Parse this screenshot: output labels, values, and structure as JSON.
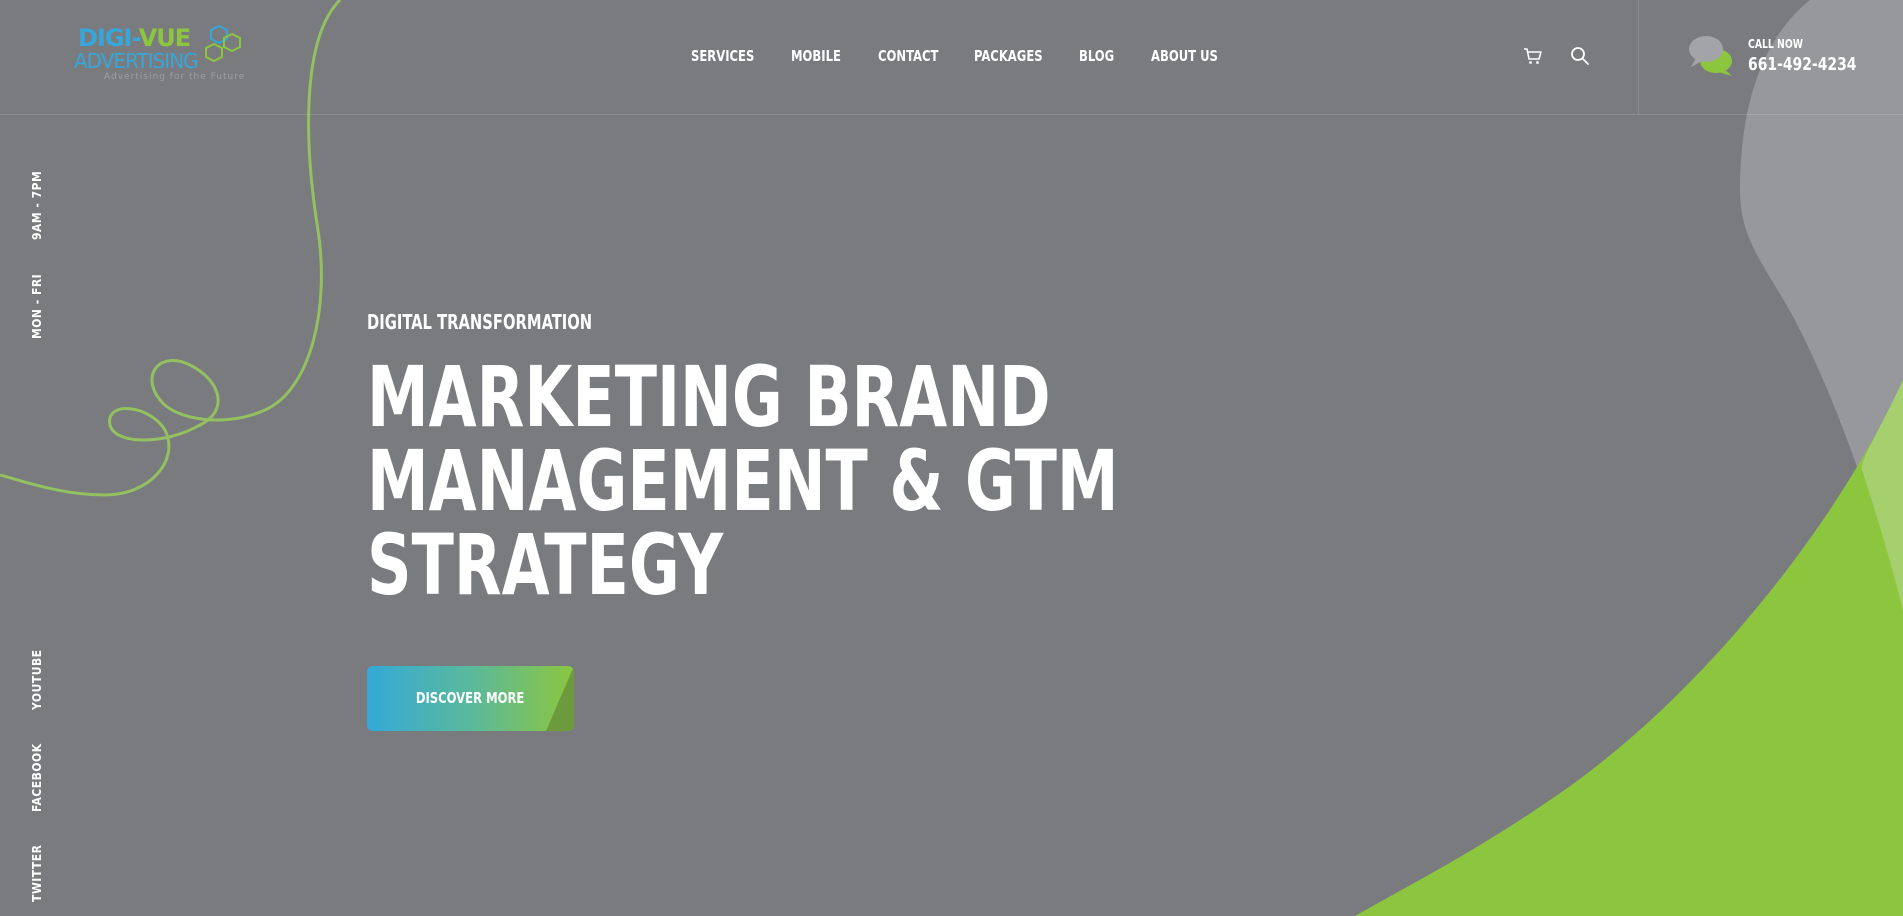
{
  "brand": {
    "logo_line1_a": "DIGI-",
    "logo_line1_b": "VUE",
    "logo_line2": "ADVERTISING",
    "tagline": "Advertising for the Future"
  },
  "nav": {
    "items": [
      {
        "label": "SERVICES"
      },
      {
        "label": "MOBILE"
      },
      {
        "label": "CONTACT"
      },
      {
        "label": "PACKAGES"
      },
      {
        "label": "BLOG"
      },
      {
        "label": "ABOUT US"
      }
    ]
  },
  "header": {
    "call_label": "CALL NOW",
    "call_number": "661-492-4234"
  },
  "sidebar": {
    "hours": "9AM - 7PM",
    "days": "MON - FRI",
    "social": [
      "YOUTUBE",
      "FACEBOOK",
      "TWITTER"
    ]
  },
  "hero": {
    "eyebrow": "DIGITAL TRANSFORMATION",
    "title_lines": [
      "MARKETING BRAND",
      "MANAGEMENT & GTM",
      "STRATEGY"
    ],
    "cta_label": "DISCOVER MORE"
  },
  "colors": {
    "background": "#7a7b7f",
    "accent_green": "#8cc63f",
    "accent_blue": "#34a9d8",
    "shape_gray": "#97989b",
    "swirl": "#93c060"
  }
}
